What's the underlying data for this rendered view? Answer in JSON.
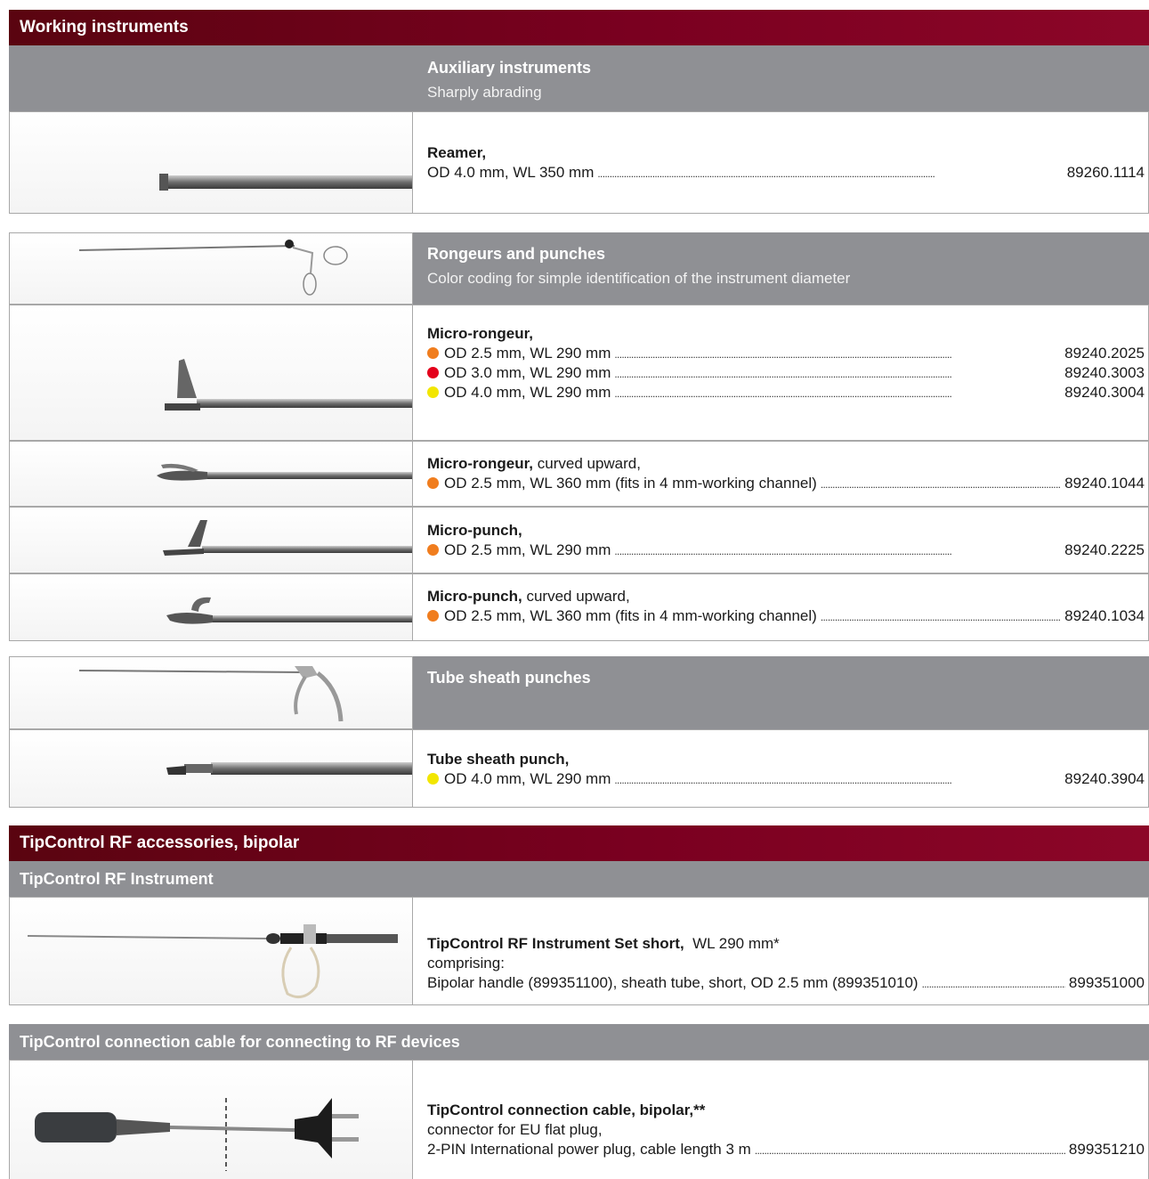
{
  "colors": {
    "band": "#7a0020",
    "gray": "#8f9094",
    "orange": "#f07d1e",
    "red": "#e4001b",
    "yellow": "#f2e600"
  },
  "working": {
    "title": "Working instruments",
    "aux": {
      "heading": "Auxiliary instruments",
      "sub": "Sharply abrading"
    },
    "reamer": {
      "name": "Reamer,",
      "spec": "OD 4.0 mm, WL 350 mm",
      "code": "89260.1114"
    },
    "rongeurs": {
      "heading": "Rongeurs and punches",
      "sub": "Color coding for simple identification of the instrument diameter"
    },
    "micro_rongeur": {
      "name": "Micro-rongeur,",
      "items": [
        {
          "color": "orange",
          "spec": "OD 2.5 mm, WL 290 mm",
          "code": "89240.2025"
        },
        {
          "color": "red",
          "spec": "OD 3.0 mm, WL 290 mm",
          "code": "89240.3003"
        },
        {
          "color": "yellow",
          "spec": "OD 4.0 mm, WL 290 mm",
          "code": "89240.3004"
        }
      ]
    },
    "micro_rongeur_curved": {
      "name": "Micro-rongeur,",
      "suffix": "curved upward,",
      "color": "orange",
      "spec": "OD 2.5 mm, WL 360 mm (fits in 4 mm-working channel)",
      "code": "89240.1044"
    },
    "micro_punch": {
      "name": "Micro-punch,",
      "color": "orange",
      "spec": "OD 2.5 mm, WL 290 mm",
      "code": "89240.2225"
    },
    "micro_punch_curved": {
      "name": "Micro-punch,",
      "suffix": "curved upward,",
      "color": "orange",
      "spec": "OD 2.5 mm, WL 360 mm (fits in 4 mm-working channel)",
      "code": "89240.1034"
    },
    "tube_sheath": {
      "heading": "Tube sheath punches"
    },
    "tube_sheath_punch": {
      "name": "Tube sheath punch,",
      "color": "yellow",
      "spec": "OD 4.0 mm, WL 290 mm",
      "code": "89240.3904"
    }
  },
  "tipcontrol": {
    "title": "TipControl RF accessories, bipolar",
    "instrument_heading": "TipControl RF Instrument",
    "set": {
      "name": "TipControl RF Instrument Set short,",
      "suffix": "WL 290 mm*",
      "line2": "comprising:",
      "spec": "Bipolar handle (899351100), sheath tube, short, OD 2.5 mm (899351010)",
      "code": "899351000"
    },
    "cable_heading": "TipControl connection cable for connecting to RF devices",
    "cable": {
      "name": "TipControl connection cable, bipolar,**",
      "line2": "connector for EU flat plug,",
      "spec": "2-PIN International power plug, cable length 3 m",
      "code": "899351210"
    }
  }
}
